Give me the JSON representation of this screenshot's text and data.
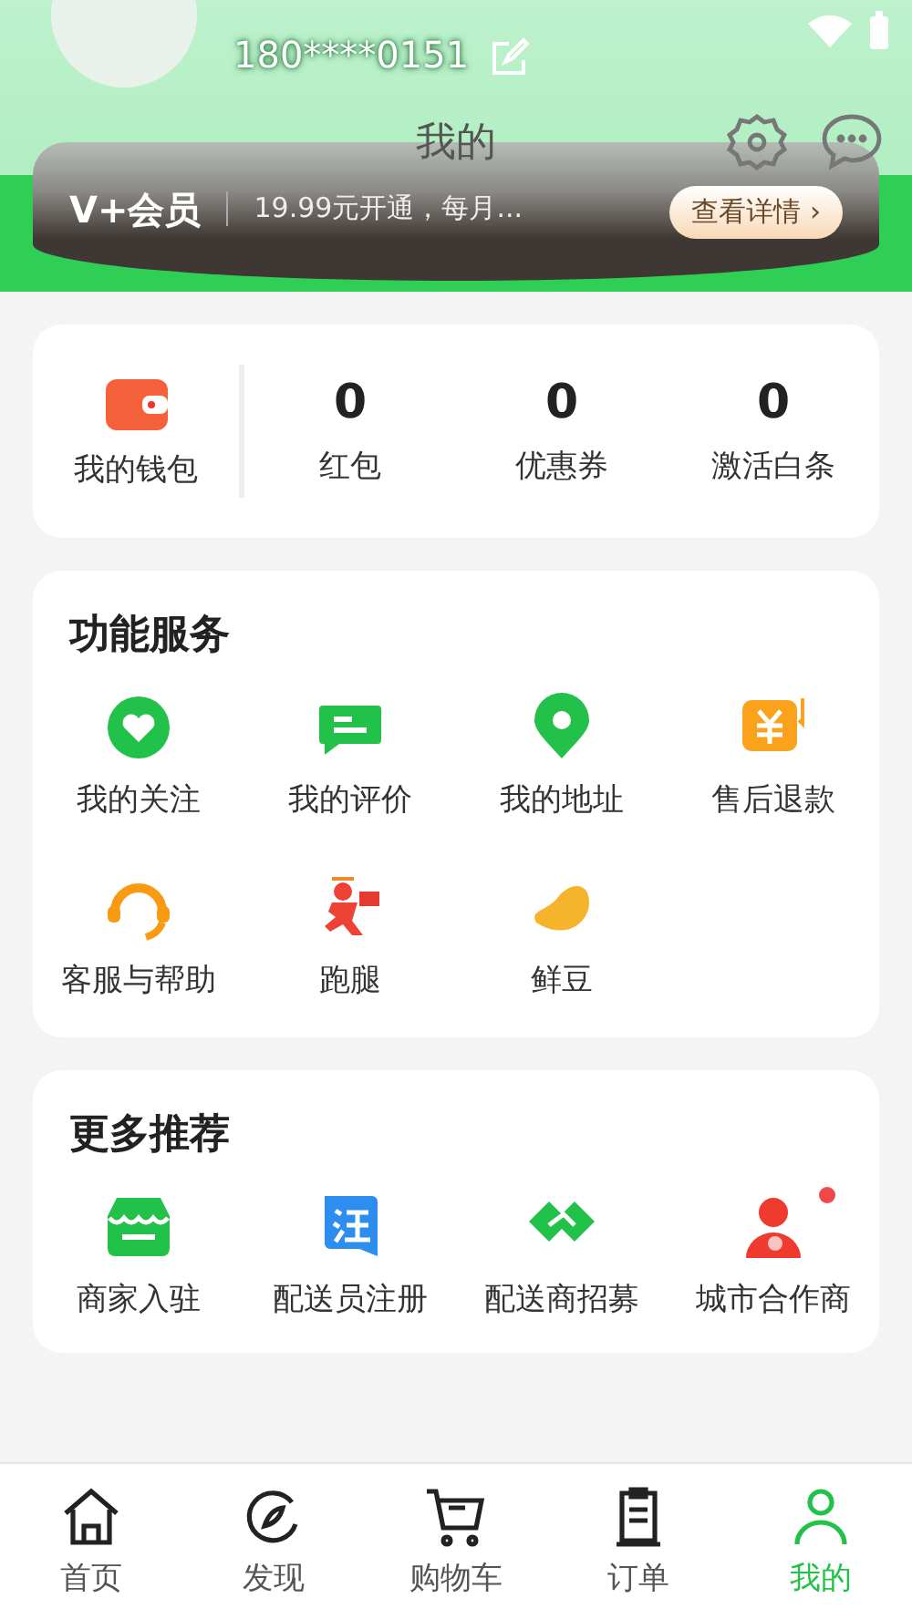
{
  "header": {
    "title": "我的",
    "phone": "180****0151",
    "vip": {
      "logo": "V+会员",
      "text": "19.99元开通，每月...",
      "button": "查看详情 ›"
    }
  },
  "wallet": {
    "label": "我的钱包",
    "stats": [
      {
        "value": "0",
        "label": "红包"
      },
      {
        "value": "0",
        "label": "优惠券"
      },
      {
        "value": "0",
        "label": "激活白条"
      }
    ]
  },
  "services": {
    "title": "功能服务",
    "items": [
      {
        "kind": "heart",
        "label": "我的关注"
      },
      {
        "kind": "comment",
        "label": "我的评价"
      },
      {
        "kind": "pin",
        "label": "我的地址"
      },
      {
        "kind": "refund",
        "label": "售后退款"
      },
      {
        "kind": "headset",
        "label": "客服与帮助"
      },
      {
        "kind": "runner",
        "label": "跑腿"
      },
      {
        "kind": "bean",
        "label": "鲜豆"
      }
    ]
  },
  "more": {
    "title": "更多推荐",
    "items": [
      {
        "kind": "shop",
        "label": "商家入驻",
        "badge": false
      },
      {
        "kind": "register",
        "label": "配送员注册",
        "badge": false
      },
      {
        "kind": "handshake",
        "label": "配送商招募",
        "badge": false
      },
      {
        "kind": "partner",
        "label": "城市合作商",
        "badge": true
      }
    ]
  },
  "tabs": [
    {
      "kind": "home",
      "label": "首页",
      "selected": false
    },
    {
      "kind": "discover",
      "label": "发现",
      "selected": false
    },
    {
      "kind": "cart",
      "label": "购物车",
      "selected": false
    },
    {
      "kind": "orders",
      "label": "订单",
      "selected": false
    },
    {
      "kind": "me",
      "label": "我的",
      "selected": true
    }
  ]
}
